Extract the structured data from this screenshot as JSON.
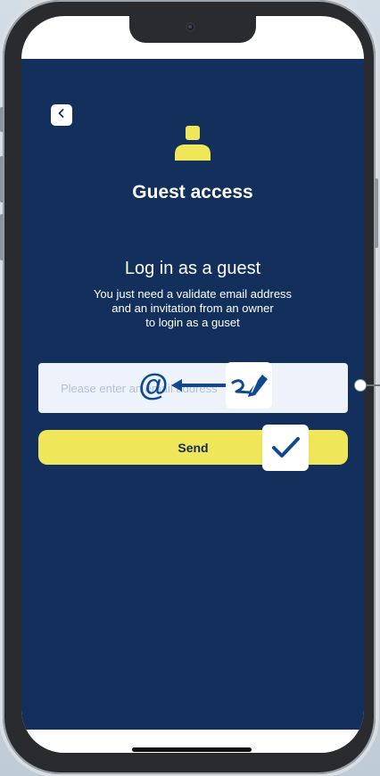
{
  "app": {
    "title": "Guest access",
    "subtitle": "Log in as a guest",
    "description": "You just need a validate email address\nand an invitation from an owner\nto login as a guset",
    "email_input": {
      "placeholder": "Please enter an email address",
      "value": ""
    },
    "send_label": "Send"
  },
  "icons": {
    "back": "chevron-left-icon",
    "user": "user-icon",
    "at": "at-sign-icon",
    "arrow": "arrow-left-icon",
    "pen": "signature-pen-icon",
    "check": "checkmark-icon"
  },
  "overlay": {
    "at_symbol": "@"
  },
  "colors": {
    "background": "#13305c",
    "accent": "#efe65a",
    "input_bg": "#eef2fb",
    "icon_blue": "#0f4a91",
    "user_icon": "#efe65a"
  }
}
